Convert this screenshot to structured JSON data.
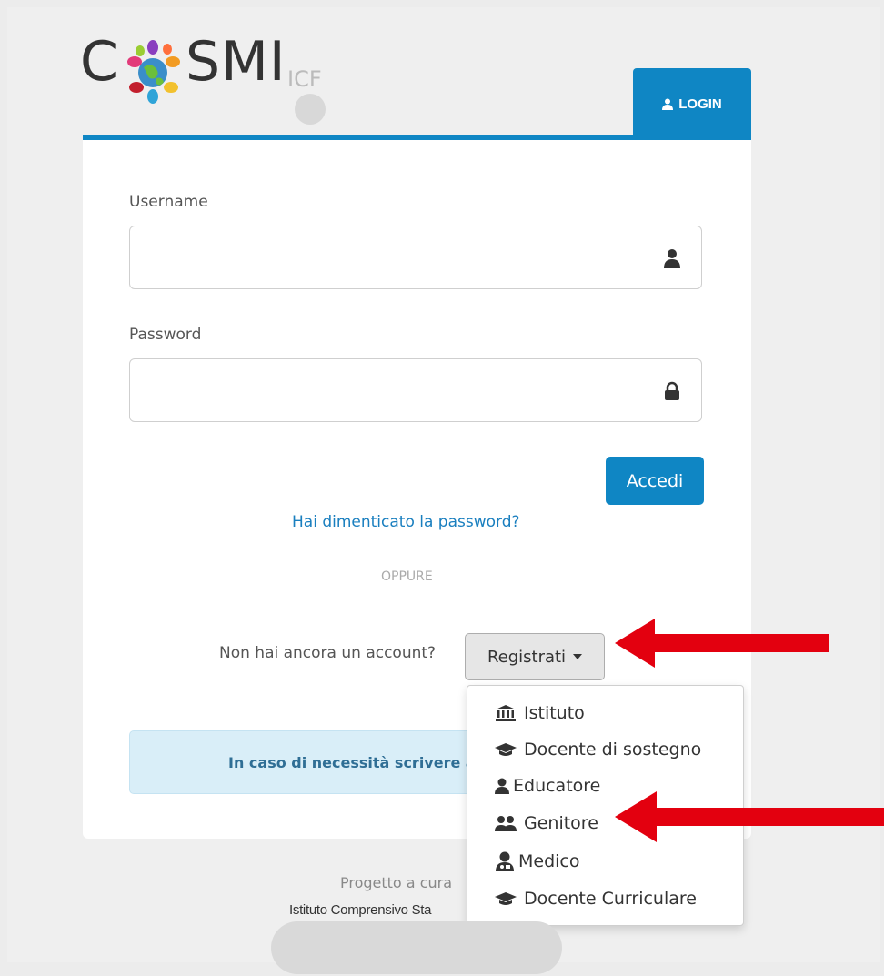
{
  "logo": {
    "text_left": "C",
    "text_right": "SMI",
    "suffix": "ICF"
  },
  "tab": {
    "label": "LOGIN",
    "icon": "user-icon"
  },
  "form": {
    "username_label": "Username",
    "username_value": "",
    "password_label": "Password",
    "password_value": "",
    "submit_label": "Accedi",
    "forgot_link": "Hai dimenticato la password?",
    "separator": "OPPURE",
    "no_account_text": "Non hai ancora un account?",
    "register_label": "Registrati"
  },
  "info": {
    "text": "In caso di necessità scrivere a"
  },
  "dropdown": {
    "items": [
      {
        "label": "Istituto",
        "icon": "institution-icon"
      },
      {
        "label": "Docente di sostegno",
        "icon": "graduation-cap-icon"
      },
      {
        "label": "Educatore",
        "icon": "user-icon"
      },
      {
        "label": "Genitore",
        "icon": "users-icon"
      },
      {
        "label": "Medico",
        "icon": "user-md-icon"
      },
      {
        "label": "Docente Curriculare",
        "icon": "graduation-cap-icon"
      }
    ]
  },
  "footer": {
    "line1": "Progetto a cura",
    "line2": "Istituto Comprensivo Sta"
  },
  "colors": {
    "accent": "#0f86c4",
    "arrow": "#e3000f"
  }
}
